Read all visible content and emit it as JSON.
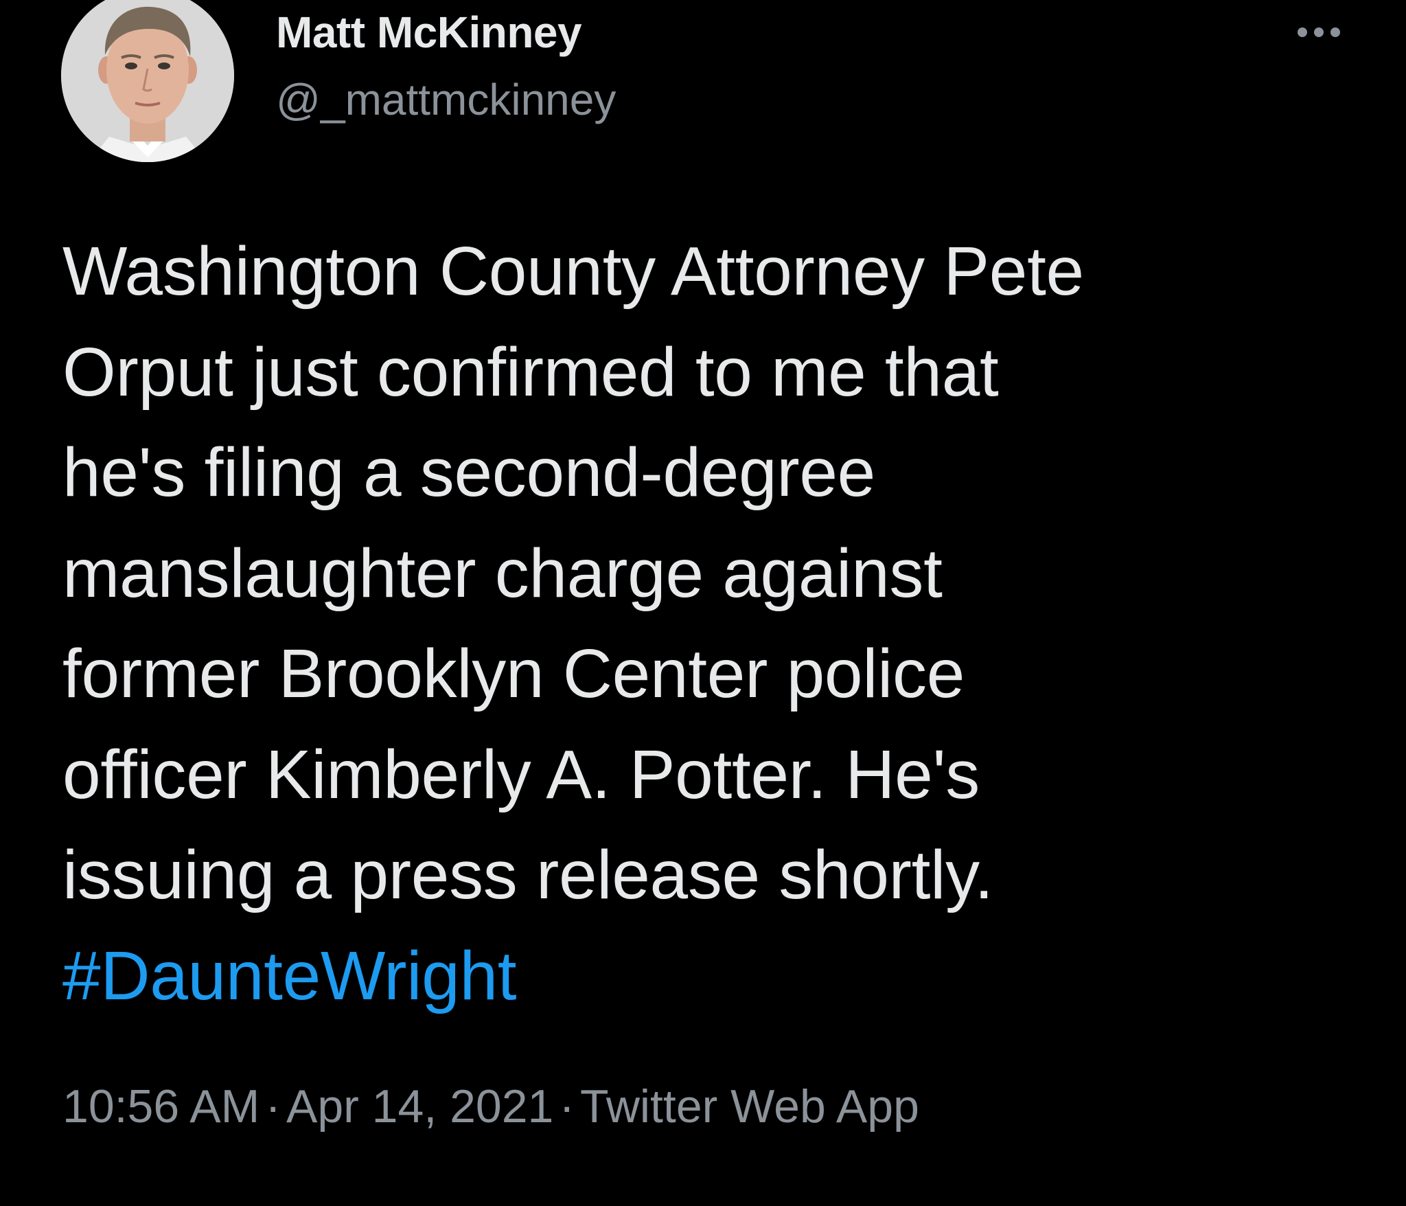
{
  "tweet": {
    "author": {
      "display_name": "Matt McKinney",
      "handle": "@_mattmckinney",
      "avatar_icon": "profile-photo"
    },
    "more_icon": "more-horizontal-icon",
    "text_lines": [
      "Washington County Attorney Pete",
      "Orput just confirmed to me that",
      "he's filing a second-degree",
      "manslaughter charge against",
      "former Brooklyn Center police",
      "officer Kimberly A. Potter. He's",
      "issuing a press release shortly."
    ],
    "hashtag": "#DaunteWright",
    "time": "10:56 AM",
    "separator": "·",
    "date": "Apr 14, 2021",
    "source": "Twitter Web App"
  },
  "colors": {
    "background": "#000000",
    "text_primary": "#e7e9ea",
    "text_secondary": "#8b9299",
    "link": "#1d9bf0"
  }
}
